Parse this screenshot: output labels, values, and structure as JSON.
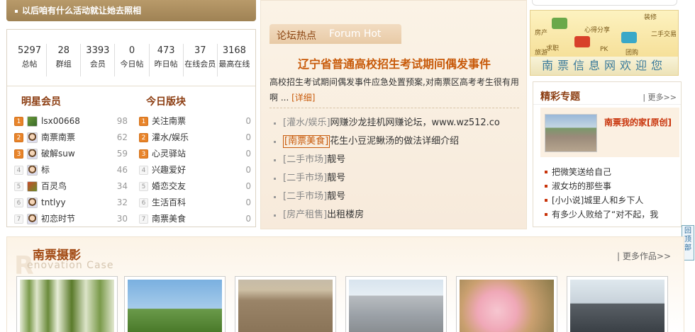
{
  "banner": {
    "text": "以后咱有什么活动就让她去照相"
  },
  "stats": [
    {
      "num": "5297",
      "label": "总帖"
    },
    {
      "num": "28",
      "label": "群组"
    },
    {
      "num": "3393",
      "label": "会员"
    },
    {
      "num": "0",
      "label": "今日帖"
    },
    {
      "num": "473",
      "label": "昨日帖"
    },
    {
      "num": "37",
      "label": "在线会员"
    },
    {
      "num": "3168",
      "label": "最高在线"
    }
  ],
  "members": {
    "title": "明星会员",
    "items": [
      {
        "rank": "1",
        "name": "lsx00668",
        "count": "98"
      },
      {
        "rank": "2",
        "name": "南票南票",
        "count": "62"
      },
      {
        "rank": "3",
        "name": "破解suw",
        "count": "59"
      },
      {
        "rank": "4",
        "name": "标",
        "count": "46"
      },
      {
        "rank": "5",
        "name": "百灵鸟",
        "count": "34"
      },
      {
        "rank": "6",
        "name": "tntlyy",
        "count": "32"
      },
      {
        "rank": "7",
        "name": "初恋时节",
        "count": "30"
      }
    ]
  },
  "boards": {
    "title": "今日版块",
    "items": [
      {
        "rank": "1",
        "name": "关注南票",
        "count": "0"
      },
      {
        "rank": "2",
        "name": "灌水/娱乐",
        "count": "0"
      },
      {
        "rank": "3",
        "name": "心灵驿站",
        "count": "0"
      },
      {
        "rank": "4",
        "name": "兴趣爱好",
        "count": "0"
      },
      {
        "rank": "5",
        "name": "婚恋交友",
        "count": "0"
      },
      {
        "rank": "6",
        "name": "生活百科",
        "count": "0"
      },
      {
        "rank": "7",
        "name": "南票美食",
        "count": "0"
      }
    ]
  },
  "forum_hot": {
    "tab_cn": "论坛热点",
    "tab_en": "Forum Hot",
    "headline": "辽宁省普通高校招生考试期间偶发事件",
    "summary": "高校招生考试期间偶发事件应急处置预案,对南票区高考考生很有用啊 ...",
    "more": "[详细]",
    "news": [
      {
        "cat": "[灌水/娱乐]",
        "title": "网赚沙龙挂机网赚论坛，www.wz512.co",
        "boxed": false
      },
      {
        "cat": "[南票美食]",
        "title": "花生小豆泥鳅汤的做法详细介绍",
        "boxed": true
      },
      {
        "cat": "[二手市场]",
        "title": "靓号",
        "boxed": false
      },
      {
        "cat": "[二手市场]",
        "title": "靓号",
        "boxed": false
      },
      {
        "cat": "[二手市场]",
        "title": "靓号",
        "boxed": false
      },
      {
        "cat": "[房产租售]",
        "title": "出租楼房",
        "boxed": false
      }
    ]
  },
  "ad": {
    "tags": [
      "房产",
      "心得分享",
      "二手交易",
      "装修",
      "求职",
      "PK",
      "旅游",
      "团购"
    ],
    "welcome": "南票信息网欢迎您"
  },
  "special": {
    "title": "精彩专题",
    "more": "| 更多>>",
    "feature_title": "南票我的家[原创]",
    "items": [
      "把微笑送给自己",
      "淑女坊的那些事",
      "[小小说]城里人和乡下人",
      "有多少人败给了“对不起，我"
    ]
  },
  "scroll_top": "回顶部",
  "photo": {
    "title": "南票摄影",
    "big_letter": "R",
    "en": "enovation Case",
    "more": "| 更多作品>>"
  },
  "colors": {
    "accent": "#c85a0a",
    "title_brown": "#8b3c10",
    "banner": "#a88b5c"
  }
}
